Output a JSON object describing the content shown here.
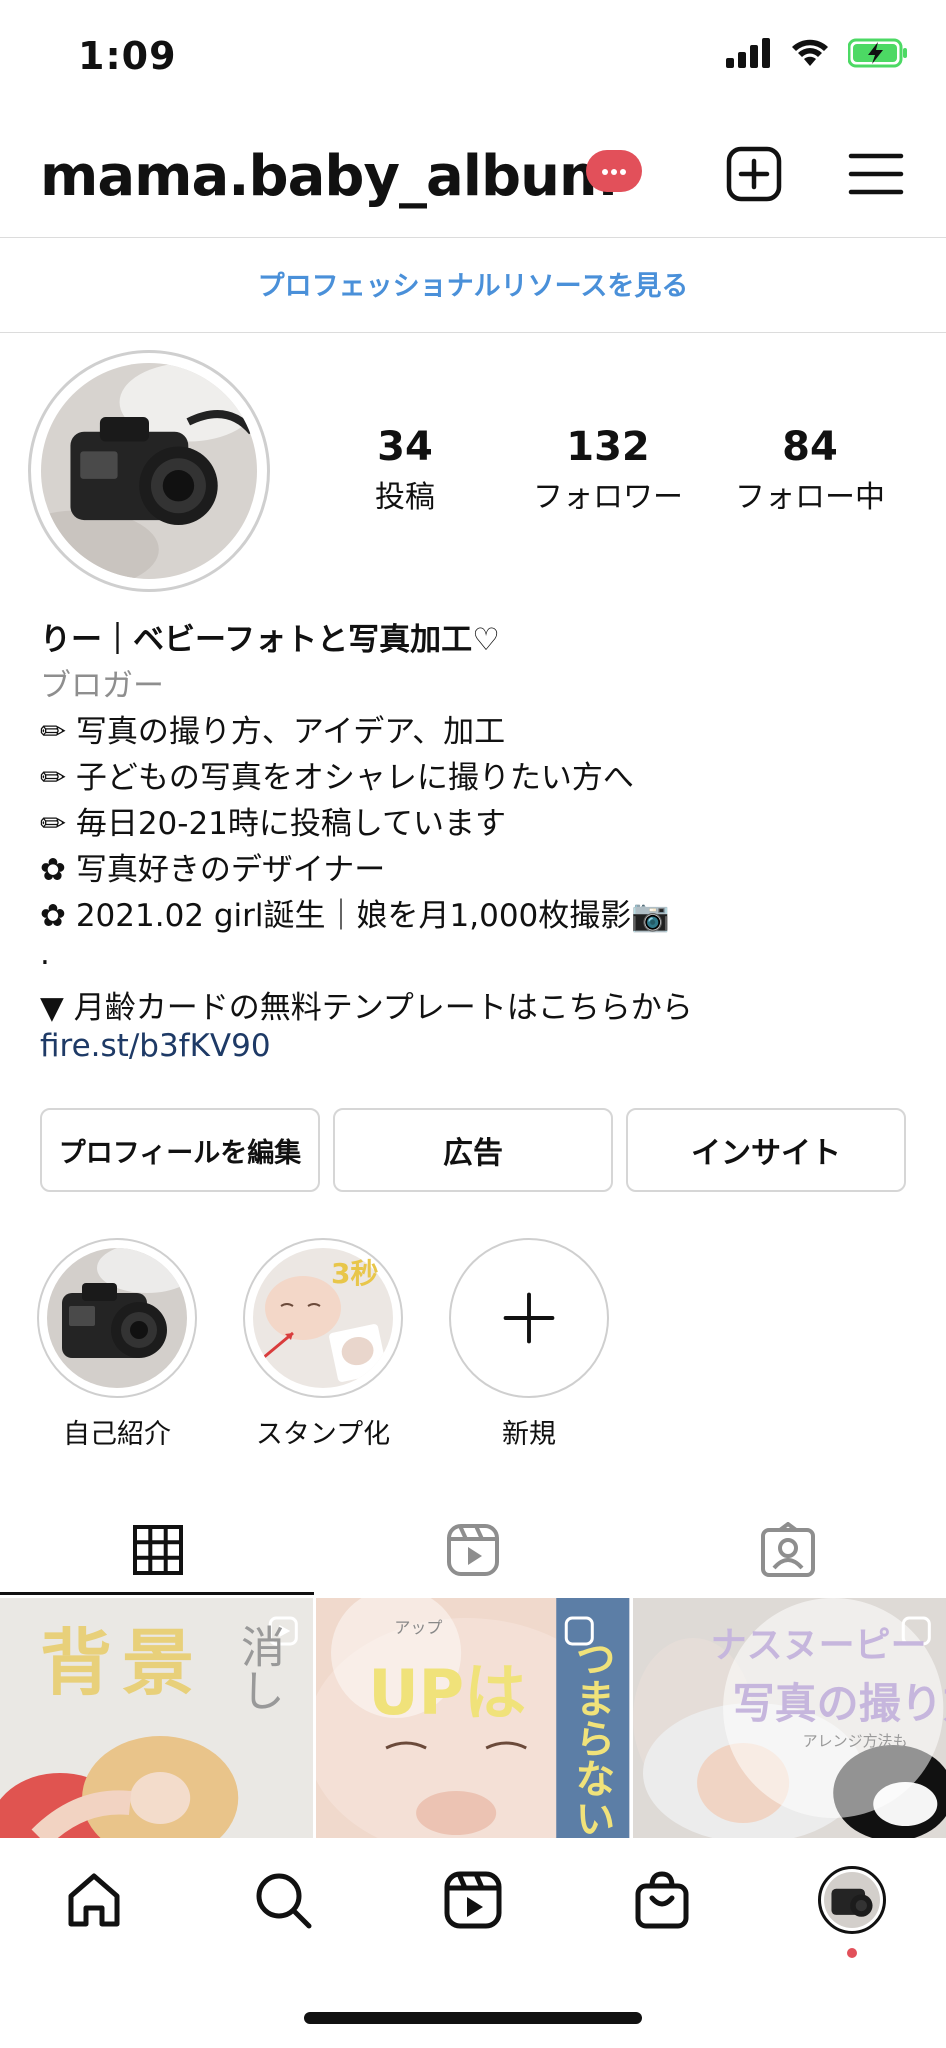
{
  "status_bar": {
    "time": "1:09"
  },
  "header": {
    "username": "mama.baby_album"
  },
  "pro_resources": "プロフェッショナルリソースを見る",
  "stats": [
    {
      "value": "34",
      "label": "投稿"
    },
    {
      "value": "132",
      "label": "フォロワー"
    },
    {
      "value": "84",
      "label": "フォロー中"
    }
  ],
  "bio": {
    "name": "りー｜ベビーフォトと写真加工♡",
    "category": "ブロガー",
    "lines": [
      "✏ 写真の撮り方、アイデア、加工",
      "✏ 子どもの写真をオシャレに撮りたい方へ",
      "✏ 毎日20-21時に投稿しています",
      "✿ 写真好きのデザイナー",
      "✿ 2021.02 girl誕生｜娘を月1,000枚撮影📷",
      ".",
      "▼ 月齢カードの無料テンプレートはこちらから"
    ],
    "link": "fire.st/b3fKV90"
  },
  "buttons": {
    "edit_profile": "プロフィールを編集",
    "ads": "広告",
    "insights": "インサイト"
  },
  "highlights": [
    {
      "label": "自己紹介"
    },
    {
      "label": "スタンプ化"
    },
    {
      "label": "新規"
    }
  ],
  "tabs": [
    "grid-icon",
    "reels-icon",
    "tagged-icon"
  ],
  "posts": [
    {
      "text_main": "背景",
      "text_sub": "消し"
    },
    {
      "text_main": "UPは",
      "text_sub": "つまらない",
      "ruby": "アップ"
    },
    {
      "text_main": "ナスヌーピー",
      "text_sub": "写真の撮り方",
      "text_small": "アレンジ方法も"
    }
  ],
  "highlight_text": {
    "stamp_badge": "3秒",
    "stamp_caption": "スタンプ化"
  },
  "colors": {
    "accent_blue": "#4a90d9",
    "badge_red": "#e2505a",
    "link_navy": "#1e3a66",
    "battery_green": "#4cd964"
  }
}
